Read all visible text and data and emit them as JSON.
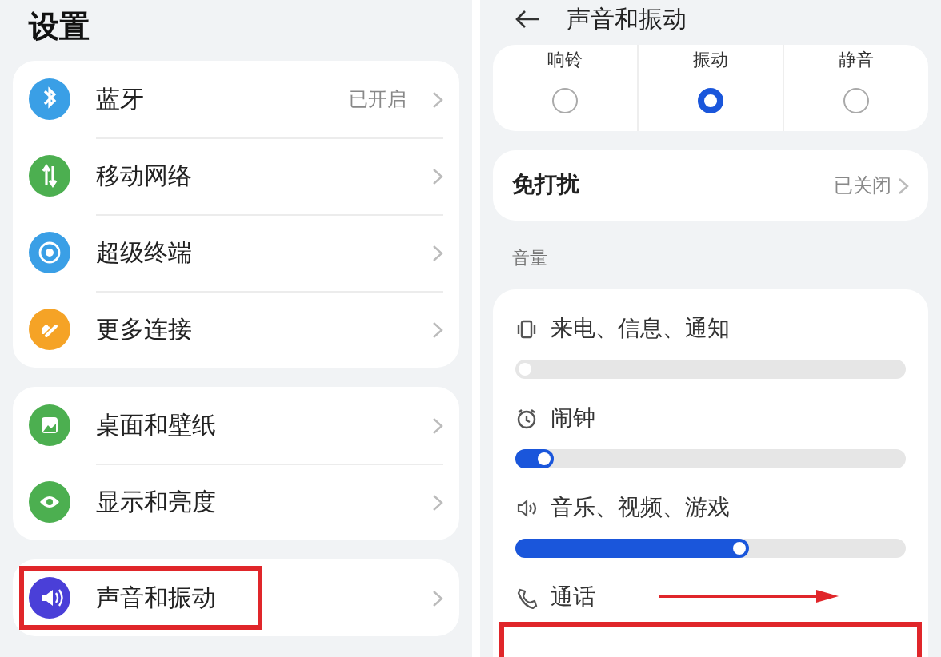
{
  "settings": {
    "title": "设置",
    "groups": [
      {
        "items": [
          {
            "label": "蓝牙",
            "value": "已开启",
            "kind": "bluetooth",
            "color": "#3a9fe6",
            "highlighted": false
          },
          {
            "label": "移动网络",
            "kind": "network",
            "color": "#4caf50",
            "highlighted": false
          },
          {
            "label": "超级终端",
            "kind": "rings",
            "color": "#3a9fe6",
            "highlighted": false
          },
          {
            "label": "更多连接",
            "kind": "link",
            "color": "#f5a326",
            "highlighted": false
          }
        ]
      },
      {
        "items": [
          {
            "label": "桌面和壁纸",
            "kind": "image",
            "color": "#4caf50",
            "highlighted": false
          },
          {
            "label": "显示和亮度",
            "kind": "eye",
            "color": "#4caf50",
            "highlighted": false
          }
        ]
      },
      {
        "items": [
          {
            "label": "声音和振动",
            "kind": "speaker",
            "color": "#4a3fd8",
            "highlighted": true
          }
        ]
      }
    ]
  },
  "sound": {
    "title": "声音和振动",
    "modes": [
      {
        "label": "响铃",
        "selected": false
      },
      {
        "label": "振动",
        "selected": true
      },
      {
        "label": "静音",
        "selected": false
      }
    ],
    "dnd": {
      "label": "免打扰",
      "value": "已关闭"
    },
    "volume_heading": "音量",
    "volumes": [
      {
        "label": "来电、信息、通知",
        "kind": "vibrate",
        "level": 0,
        "highlighted": false
      },
      {
        "label": "闹钟",
        "kind": "clock",
        "level": 0.1,
        "highlighted": false
      },
      {
        "label": "音乐、视频、游戏",
        "kind": "speaker",
        "level": 0.6,
        "highlighted": false
      },
      {
        "label": "通话",
        "kind": "phone",
        "highlighted": true
      }
    ]
  }
}
